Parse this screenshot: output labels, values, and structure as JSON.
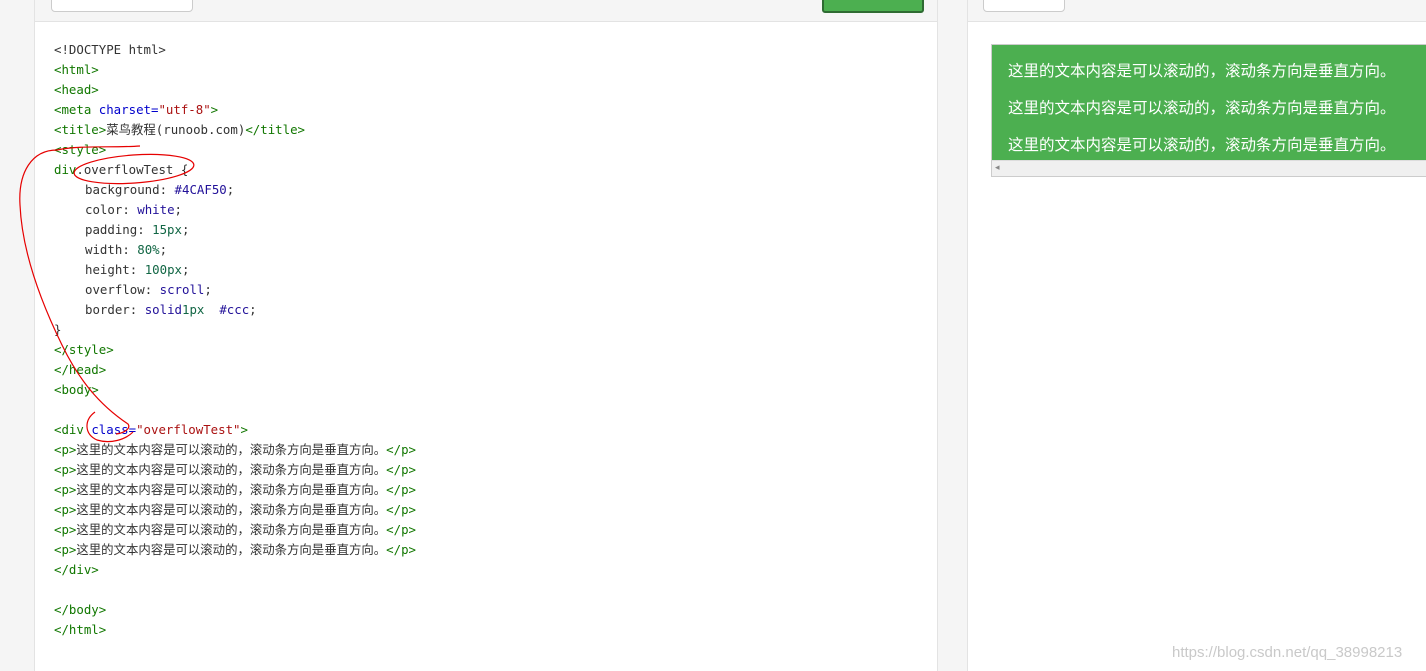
{
  "editor": {
    "lines": [
      {
        "a": "<!DOCTYPE html>"
      },
      {
        "t1": "<html>"
      },
      {
        "t1": "<head>"
      },
      {
        "t1": "<meta ",
        "a1": "charset=",
        "s1": "\"utf-8\"",
        "t2": ">"
      },
      {
        "t1": "<title>",
        "x1": "菜鸟教程(runoob.com)",
        "t2": "</title>"
      },
      {
        "t1": "<style>"
      },
      {
        "t1": "div",
        "x1": ".overflowTest {"
      },
      {
        "p": "background",
        "x1": ": ",
        "k": "#4CAF50",
        "x2": ";"
      },
      {
        "p": "color",
        "x1": ": ",
        "k": "white",
        "x2": ";"
      },
      {
        "p": "padding",
        "x1": ": ",
        "n": "15px",
        "x2": ";"
      },
      {
        "p": "width",
        "x1": ": ",
        "n": "80%",
        "x2": ";"
      },
      {
        "p": "height",
        "x1": ": ",
        "n": "100px",
        "x2": ";"
      },
      {
        "p": "overflow",
        "x1": ": ",
        "k": "scroll",
        "x2": ";"
      },
      {
        "p": "border",
        "x1": ": ",
        "n": "1px",
        "x2": " ",
        "k": "solid",
        "x3": " ",
        "k2": "#ccc",
        "x4": ";"
      },
      {
        "x1": "}"
      },
      {
        "t1": "</style>"
      },
      {
        "t1": "</head>"
      },
      {
        "t1": "<body>"
      },
      {},
      {
        "t1": "<div ",
        "a1": "class=",
        "s1": "\"overflowTest\"",
        "t2": ">"
      },
      {
        "t1": "<p>",
        "x1": "这里的文本内容是可以滚动的，滚动条方向是垂直方向。",
        "t2": "</p>"
      },
      {
        "t1": "<p>",
        "x1": "这里的文本内容是可以滚动的，滚动条方向是垂直方向。",
        "t2": "</p>"
      },
      {
        "t1": "<p>",
        "x1": "这里的文本内容是可以滚动的，滚动条方向是垂直方向。",
        "t2": "</p>"
      },
      {
        "t1": "<p>",
        "x1": "这里的文本内容是可以滚动的，滚动条方向是垂直方向。",
        "t2": "</p>"
      },
      {
        "t1": "<p>",
        "x1": "这里的文本内容是可以滚动的，滚动条方向是垂直方向。",
        "t2": "</p>"
      },
      {
        "t1": "<p>",
        "x1": "这里的文本内容是可以滚动的，滚动条方向是垂直方向。",
        "t2": "</p>"
      },
      {
        "t1": "</div>"
      },
      {},
      {
        "t1": "</body>"
      },
      {
        "t1": "</html>"
      }
    ]
  },
  "preview": {
    "bg": "#4CAF50",
    "paragraphs": [
      "这里的文本内容是可以滚动的，滚动条方向是垂直方向。",
      "这里的文本内容是可以滚动的，滚动条方向是垂直方向。",
      "这里的文本内容是可以滚动的，滚动条方向是垂直方向。"
    ],
    "scroll_arrow": "◂"
  },
  "colors": {
    "tag": "#117700",
    "attr": "#0000cc",
    "string": "#aa1111",
    "number": "#116644",
    "keyword": "#221199",
    "annotation": "#e60000"
  },
  "watermark": "https://blog.csdn.net/qq_38998213"
}
